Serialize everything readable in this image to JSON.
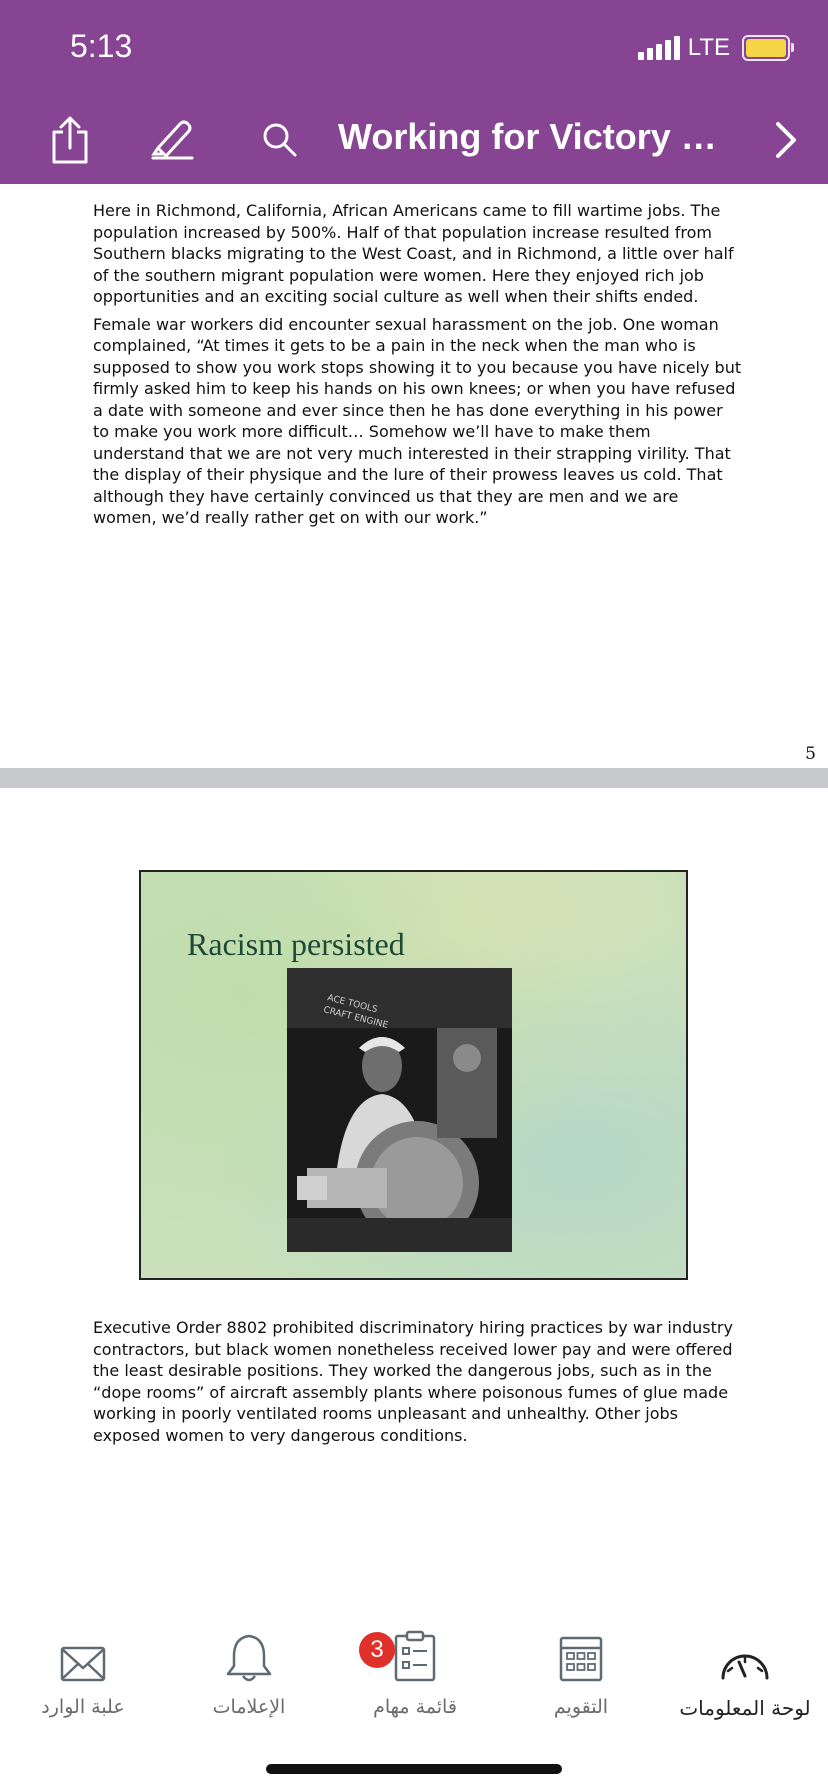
{
  "status_bar": {
    "time": "5:13",
    "network": "LTE",
    "battery_color": "#f5d547"
  },
  "header": {
    "background": "#874493",
    "title": "Working for Victory PP...",
    "icons": [
      "share-icon",
      "highlighter-icon",
      "search-icon",
      "chevron-right-icon"
    ]
  },
  "document": {
    "page_top": {
      "paragraphs": [
        "Here in Richmond, California, African Americans came to fill wartime jobs.  The population increased by 500%.  Half of that population increase resulted from Southern blacks migrating to the West Coast, and in Richmond, a little over half of the southern migrant population were women.  Here they enjoyed rich job opportunities and an exciting social culture as well when their shifts ended.",
        "Female war workers did encounter sexual harassment on the job.  One woman complained, “At times it gets to be a pain in the neck when the man who is supposed to show you work stops showing it to you because you have nicely but firmly asked him to keep his hands on his own knees; or when you have refused a date with someone and ever since then he has done everything in his power to make you work more difficult… Somehow we’ll have to make them understand that we are not very much interested in their strapping virility.  That the display of their physique and the lure of their prowess leaves us cold.  That although they have certainly convinced us that they are men and we are women, we’d really rather get on with our work.”"
      ],
      "page_number": "5"
    },
    "page_next": {
      "slide_title": "Racism persisted",
      "photo_sign_text": "ACE TOOLS\nCRAFT ENGINE",
      "paragraph": "Executive Order 8802 prohibited discriminatory hiring practices by war industry contractors, but black women nonetheless received lower pay and were offered the least desirable positions.  They worked the dangerous jobs, such as in the “dope rooms”  of aircraft assembly plants where poisonous fumes of glue made working in poorly ventilated rooms unpleasant and unhealthy.  Other jobs exposed women to very dangerous conditions."
    }
  },
  "tabbar": {
    "tabs": [
      {
        "label": "علبة الوارد",
        "icon": "mail-icon"
      },
      {
        "label": "الإعلامات",
        "icon": "bell-icon"
      },
      {
        "label": "قائمة مهام",
        "icon": "clipboard-icon",
        "badge": "3"
      },
      {
        "label": "التقويم",
        "icon": "calendar-icon"
      },
      {
        "label": "لوحة المعلومات",
        "icon": "dashboard-icon",
        "active": true
      }
    ],
    "badge_color": "#e0302a"
  }
}
